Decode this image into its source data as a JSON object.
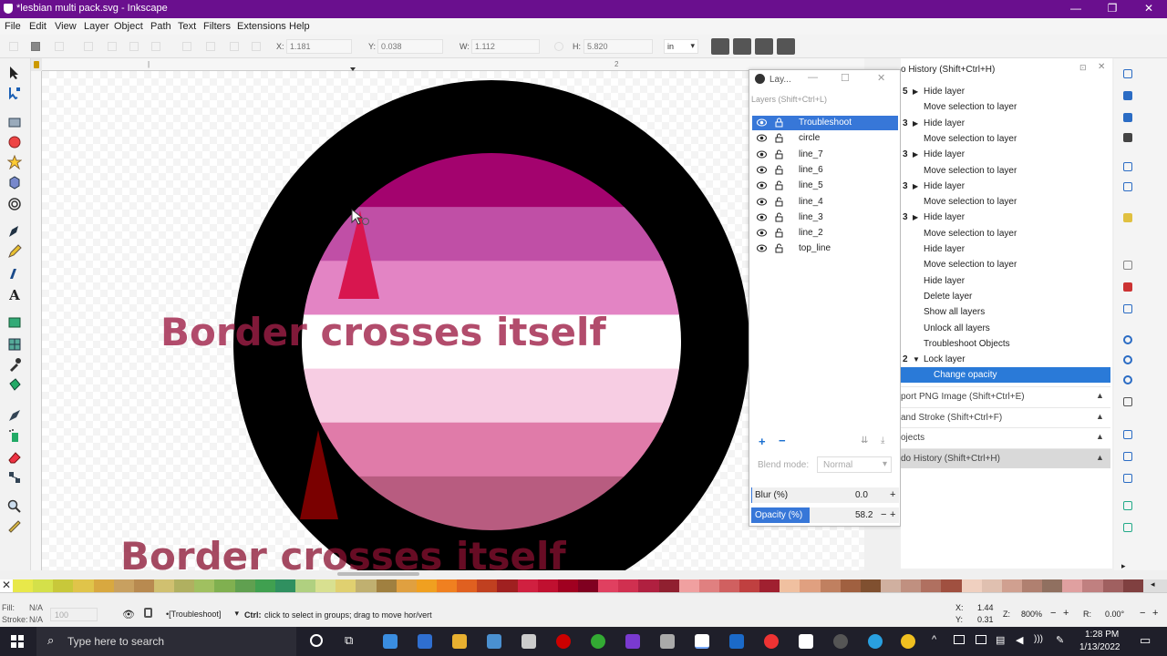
{
  "window": {
    "title": "*lesbian multi pack.svg - Inkscape"
  },
  "menu": [
    "File",
    "Edit",
    "View",
    "Layer",
    "Object",
    "Path",
    "Text",
    "Filters",
    "Extensions",
    "Help"
  ],
  "toolctrl": {
    "x_label": "X:",
    "x_value": "1.181",
    "y_label": "Y:",
    "y_value": "0.038",
    "w_label": "W:",
    "w_value": "1.112",
    "h_label": "H:",
    "h_value": "5.820",
    "unit": "in"
  },
  "canvas": {
    "text_front": "Border crosses itself",
    "text_back": "Border crosses itself",
    "stripe_colors": [
      "#a3036e",
      "#c04fa6",
      "#e384c4",
      "#ffffff",
      "#f7cde3",
      "#e07ba9",
      "#b85c80"
    ],
    "colors": {
      "ring": "#000000",
      "text_front": "#a02048",
      "triangle_top": "#d8164f",
      "triangle_bottom": "#7a0000"
    }
  },
  "layers_dialog": {
    "title": "Lay...",
    "subtitle": "Layers (Shift+Ctrl+L)",
    "layers": [
      "Troubleshoot",
      "circle",
      "line_7",
      "line_6",
      "line_5",
      "line_4",
      "line_3",
      "line_2",
      "top_line"
    ],
    "blend_label": "Blend mode:",
    "blend_value": "Normal",
    "blur_label": "Blur (%)",
    "blur_value": "0.0",
    "opacity_label": "Opacity (%)",
    "opacity_value": "58.2",
    "opacity_fraction": 0.582
  },
  "history": {
    "header": "o History (Shift+Ctrl+H)",
    "items": [
      {
        "num": "5",
        "expand": "▶",
        "label": "Hide layer"
      },
      {
        "num": "",
        "expand": "",
        "label": "Move selection to layer"
      },
      {
        "num": "3",
        "expand": "▶",
        "label": "Hide layer"
      },
      {
        "num": "",
        "expand": "",
        "label": "Move selection to layer"
      },
      {
        "num": "3",
        "expand": "▶",
        "label": "Hide layer"
      },
      {
        "num": "",
        "expand": "",
        "label": "Move selection to layer"
      },
      {
        "num": "3",
        "expand": "▶",
        "label": "Hide layer"
      },
      {
        "num": "",
        "expand": "",
        "label": "Move selection to layer"
      },
      {
        "num": "3",
        "expand": "▶",
        "label": "Hide layer"
      },
      {
        "num": "",
        "expand": "",
        "label": "Move selection to layer"
      },
      {
        "num": "",
        "expand": "",
        "label": "Hide layer"
      },
      {
        "num": "",
        "expand": "",
        "label": "Move selection to layer"
      },
      {
        "num": "",
        "expand": "",
        "label": "Hide layer"
      },
      {
        "num": "",
        "expand": "",
        "label": "Delete layer"
      },
      {
        "num": "",
        "expand": "",
        "label": "Show all layers"
      },
      {
        "num": "",
        "expand": "",
        "label": "Unlock all layers"
      },
      {
        "num": "",
        "expand": "",
        "label": "Troubleshoot Objects"
      },
      {
        "num": "2",
        "expand": "▼",
        "label": "Lock layer"
      },
      {
        "num": "",
        "expand": "",
        "label": "Change opacity"
      }
    ],
    "docks": [
      {
        "label": "port PNG Image (Shift+Ctrl+E)"
      },
      {
        "label": "and Stroke (Shift+Ctrl+F)"
      },
      {
        "label": "ojects"
      },
      {
        "label": "do History (Shift+Ctrl+H)"
      }
    ]
  },
  "status": {
    "fill_label": "Fill:",
    "fill_value": "N/A",
    "stroke_label": "Stroke:",
    "stroke_value": "N/A",
    "opacity_value": "100",
    "layer_name": "•[Troubleshoot]",
    "message_bold": "Ctrl:",
    "message": " click to select in groups; drag to move hor/vert",
    "x_label": "X:",
    "x_value": "1.44",
    "y_label": "Y:",
    "y_value": "0.31",
    "zoom_label": "Z:",
    "zoom_value": "800%",
    "rot_label": "R:",
    "rot_value": "0.00°"
  },
  "taskbar": {
    "search_placeholder": "Type here to search",
    "time": "1:28 PM",
    "date": "1/13/2022"
  },
  "palette": [
    "#e8e84a",
    "#d4e04a",
    "#c8c83a",
    "#e0c44a",
    "#d8a840",
    "#c8a060",
    "#b88a50",
    "#d0c070",
    "#b0b060",
    "#a0c060",
    "#80b050",
    "#60a050",
    "#40a050",
    "#309060",
    "#b0d080",
    "#d8e090",
    "#e0d070",
    "#c0b070",
    "#a08040",
    "#e0a040",
    "#f0a020",
    "#f08020",
    "#e06020",
    "#c04020",
    "#a02020",
    "#d02040",
    "#c01030",
    "#a00020",
    "#800020",
    "#e04060",
    "#d03050",
    "#b02040",
    "#902030",
    "#f0a0a0",
    "#e08080",
    "#d06060",
    "#c04040",
    "#a02030",
    "#f0c0a0",
    "#e0a080",
    "#c08060",
    "#a06040",
    "#805030",
    "#d0b0a0",
    "#c09080",
    "#b07060",
    "#a05040",
    "#f0d0c0",
    "#e0c0b0",
    "#d0a090",
    "#b08070",
    "#907060",
    "#e0a0a0",
    "#c08080",
    "#a06060",
    "#804040"
  ]
}
